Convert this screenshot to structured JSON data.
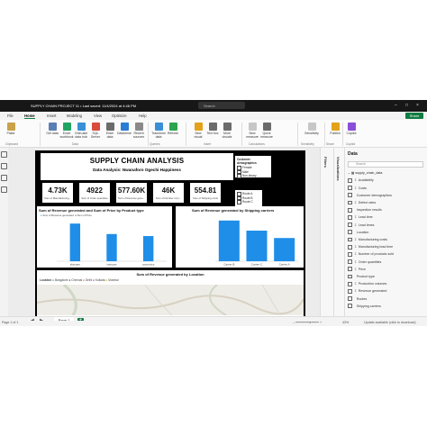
{
  "window": {
    "title": "SUPPLY CHAIN PROJECT 11 • Last saved: 11/4/2024 at 4:46 PM",
    "search_placeholder": "Search",
    "share_label": "Share"
  },
  "menu": [
    "File",
    "Home",
    "Insert",
    "Modeling",
    "View",
    "Optimize",
    "Help"
  ],
  "ribbon": {
    "buttons": [
      {
        "label": "Paste",
        "color": "#c9a24a"
      },
      {
        "label": "Get data",
        "color": "#5b7fb5"
      },
      {
        "label": "Excel workbook",
        "color": "#21a366"
      },
      {
        "label": "OneLake data hub",
        "color": "#3a8fd6"
      },
      {
        "label": "SQL Server",
        "color": "#d84b3d"
      },
      {
        "label": "Enter data",
        "color": "#6b6b6b"
      },
      {
        "label": "Dataverse",
        "color": "#2b7cd3"
      },
      {
        "label": "Recent sources",
        "color": "#8a8a8a"
      },
      {
        "label": "Transform data",
        "color": "#3a8fd6"
      },
      {
        "label": "Refresh",
        "color": "#2ea44f"
      },
      {
        "label": "New visual",
        "color": "#e3a21a"
      },
      {
        "label": "Text box",
        "color": "#6b6b6b"
      },
      {
        "label": "More visuals",
        "color": "#6b6b6b"
      },
      {
        "label": "New measure",
        "color": "#c7c7c7"
      },
      {
        "label": "Quick measure",
        "color": "#6b6b6b"
      },
      {
        "label": "Sensitivity",
        "color": "#c7c7c7"
      },
      {
        "label": "Publish",
        "color": "#e3a21a"
      },
      {
        "label": "Copilot",
        "color": "#8a4fd8"
      }
    ],
    "groups": [
      "Clipboard",
      "Data",
      "Queries",
      "Insert",
      "Calculations",
      "Sensitivity",
      "Share",
      "Copilot"
    ]
  },
  "report": {
    "title": "SUPPLY CHAIN ANALYSIS",
    "subtitle": "Data Analysis: Nwanaforo Ogechi Happiness",
    "slicer1": {
      "title": "Customer demographics",
      "options": [
        "Female",
        "Male",
        "Non-binary"
      ]
    },
    "slicer2": {
      "options": [
        "Route A",
        "Route B",
        "Route C"
      ]
    },
    "kpis": [
      {
        "value": "4.73K",
        "label": "Sum of Manufacturing..."
      },
      {
        "value": "4922",
        "label": "Sum of Order quantities"
      },
      {
        "value": "577.60K",
        "label": "Sum of Revenue gene..."
      },
      {
        "value": "46K",
        "label": "Sum of Number of pr..."
      },
      {
        "value": "554.81",
        "label": "Sum of Shipping costs"
      }
    ],
    "map_title": "Sum of Revenue generated by Location",
    "map_legend_label": "Location",
    "map_legend_items": [
      "Bangalore",
      "Chennai",
      "Delhi",
      "Kolkata",
      "Mumbai"
    ],
    "map_legend_colors": [
      "#1f8ee8",
      "#1b3a6b",
      "#d9583b",
      "#7a2a8a",
      "#e8b51f"
    ]
  },
  "chart_data": [
    {
      "type": "bar",
      "title": "Sum of Revenue generated and Sum of Price by Product type",
      "legend": [
        "Sum of Revenue generated",
        "Sum of Price"
      ],
      "categories": [
        "skincare",
        "haircare",
        "cosmetics"
      ],
      "series": [
        {
          "name": "Sum of Revenue generated",
          "values": [
            241628,
            174455,
            161521
          ]
        }
      ],
      "ylim": [
        0,
        260000
      ],
      "color": "#1f8ee8"
    },
    {
      "type": "bar",
      "title": "Sum of Revenue generated by Shipping carriers",
      "categories": [
        "Carrier B",
        "Carrier C",
        "Carrier A"
      ],
      "series": [
        {
          "values": [
            250095,
            188000,
            142629
          ]
        }
      ],
      "ylim": [
        0,
        260000
      ],
      "color": "#1f8ee8"
    }
  ],
  "panes": {
    "filters": "Filters",
    "visualizations": "Visualizations",
    "data_title": "Data",
    "search_placeholder": "Search",
    "table": "supply_chain_data",
    "fields": [
      {
        "name": "Availability",
        "sigma": true
      },
      {
        "name": "Costs",
        "sigma": true
      },
      {
        "name": "Customer demographics",
        "sigma": false
      },
      {
        "name": "Defect rates",
        "sigma": true
      },
      {
        "name": "Inspection results",
        "sigma": false
      },
      {
        "name": "Lead time",
        "sigma": true
      },
      {
        "name": "Lead times",
        "sigma": true
      },
      {
        "name": "Location",
        "sigma": false
      },
      {
        "name": "Manufacturing costs",
        "sigma": true
      },
      {
        "name": "Manufacturing lead time",
        "sigma": true
      },
      {
        "name": "Number of products sold",
        "sigma": true
      },
      {
        "name": "Order quantities",
        "sigma": true
      },
      {
        "name": "Price",
        "sigma": true
      },
      {
        "name": "Product type",
        "sigma": false
      },
      {
        "name": "Production volumes",
        "sigma": true
      },
      {
        "name": "Revenue generated",
        "sigma": true
      },
      {
        "name": "Routes",
        "sigma": false
      },
      {
        "name": "Shipping carriers",
        "sigma": false
      }
    ]
  },
  "page_tab": "Page 1",
  "status": {
    "page": "Page 1 of 1",
    "zoom": "43%",
    "update": "Update available (click to download)"
  }
}
